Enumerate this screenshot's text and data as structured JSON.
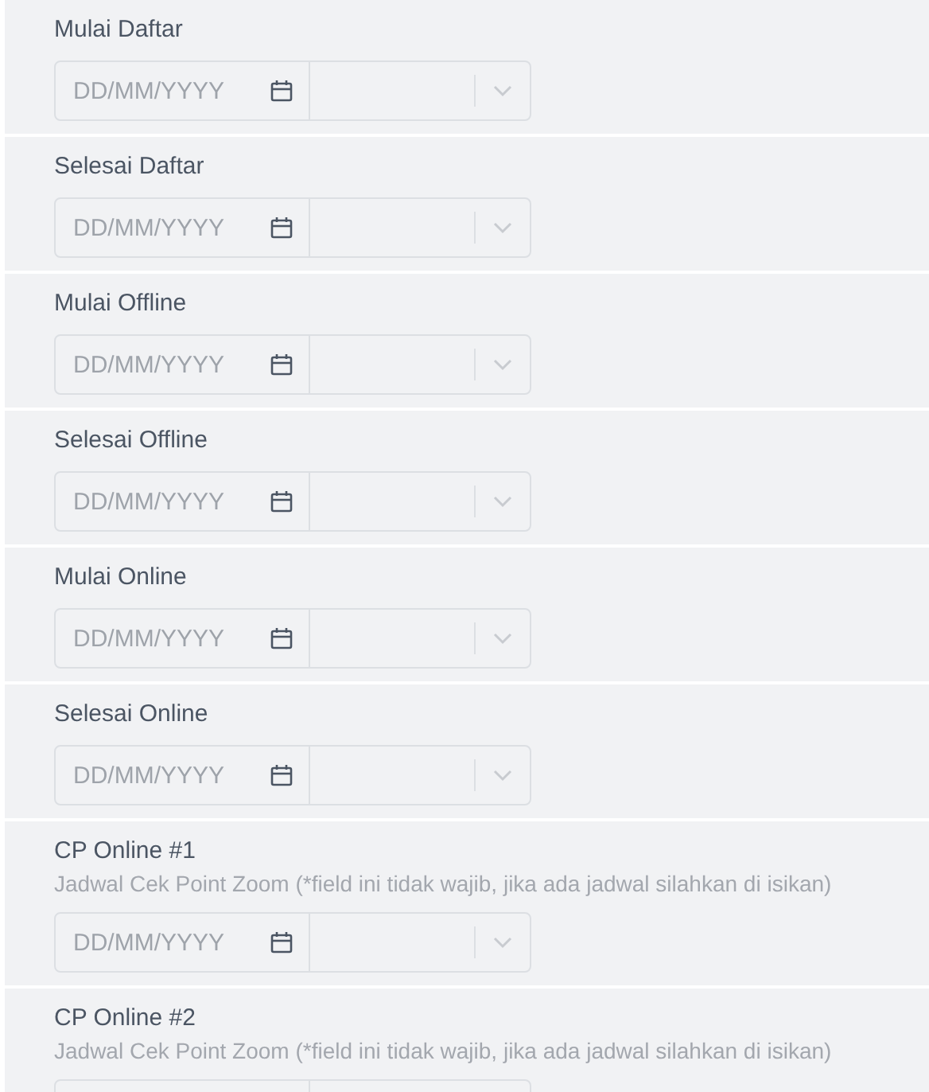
{
  "fields": [
    {
      "label": "Mulai Daftar",
      "date_placeholder": "DD/MM/YYYY"
    },
    {
      "label": "Selesai Daftar",
      "date_placeholder": "DD/MM/YYYY"
    },
    {
      "label": "Mulai Offline",
      "date_placeholder": "DD/MM/YYYY"
    },
    {
      "label": "Selesai Offline",
      "date_placeholder": "DD/MM/YYYY"
    },
    {
      "label": "Mulai Online",
      "date_placeholder": "DD/MM/YYYY"
    },
    {
      "label": "Selesai Online",
      "date_placeholder": "DD/MM/YYYY"
    },
    {
      "label": "CP Online #1",
      "hint": "Jadwal Cek Point Zoom (*field ini tidak wajib, jika ada jadwal silahkan di isikan)",
      "date_placeholder": "DD/MM/YYYY"
    },
    {
      "label": "CP Online #2",
      "hint": "Jadwal Cek Point Zoom (*field ini tidak wajib, jika ada jadwal silahkan di isikan)"
    }
  ]
}
